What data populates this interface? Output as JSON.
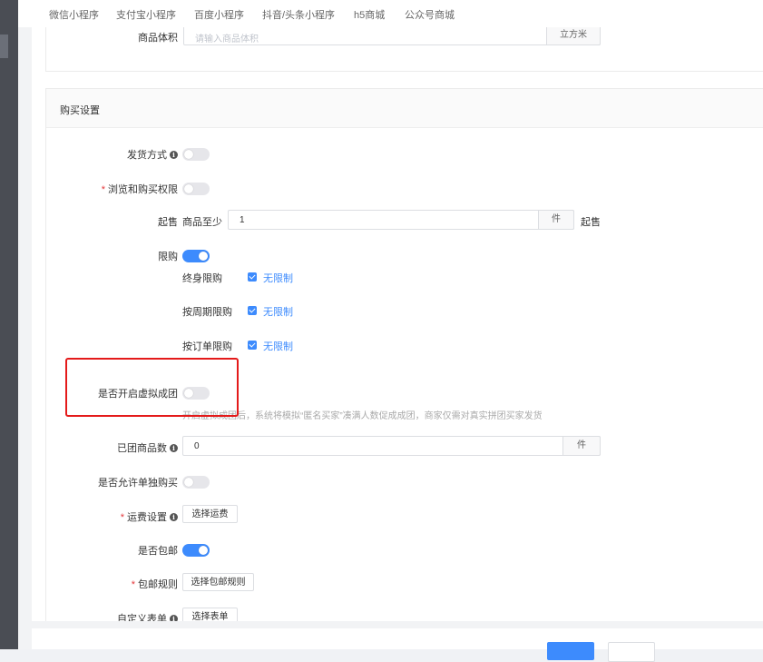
{
  "top_tabs": [
    "微信小程序",
    "支付宝小程序",
    "百度小程序",
    "抖音/头条小程序",
    "h5商城",
    "公众号商城"
  ],
  "volume": {
    "label": "商品体积",
    "placeholder": "请输入商品体积",
    "unit": "立方米"
  },
  "purchase": {
    "title": "购买设置",
    "shipping_method": {
      "label": "发货方式",
      "enabled": false
    },
    "browse_permission": {
      "label": "浏览和购买权限",
      "enabled": false
    },
    "min_sale": {
      "label": "起售",
      "prefix": "商品至少",
      "value": "1",
      "unit": "件",
      "suffix": "起售"
    },
    "limit": {
      "label": "限购",
      "enabled": true,
      "rows": [
        {
          "label": "终身限购",
          "checked": true,
          "option": "无限制"
        },
        {
          "label": "按周期限购",
          "checked": true,
          "option": "无限制"
        },
        {
          "label": "按订单限购",
          "checked": true,
          "option": "无限制"
        }
      ]
    },
    "virtual_group": {
      "label": "是否开启虚拟成团",
      "enabled": false,
      "hint": "开启虚拟成团后，系统将模拟“匿名买家”凑满人数促成成团，商家仅需对真实拼团买家发货"
    },
    "grouped_count": {
      "label": "已团商品数",
      "value": "0",
      "unit": "件"
    },
    "solo_buy": {
      "label": "是否允许单独购买",
      "enabled": false
    },
    "freight": {
      "label": "运费设置",
      "button": "选择运费"
    },
    "free_shipping": {
      "label": "是否包邮",
      "enabled": true
    },
    "free_rule": {
      "label": "包邮规则",
      "button": "选择包邮规则"
    },
    "custom_form": {
      "label": "自定义表单",
      "button": "选择表单"
    }
  },
  "colors": {
    "accent": "#3d8bfd",
    "highlight": "#e41a1a"
  }
}
